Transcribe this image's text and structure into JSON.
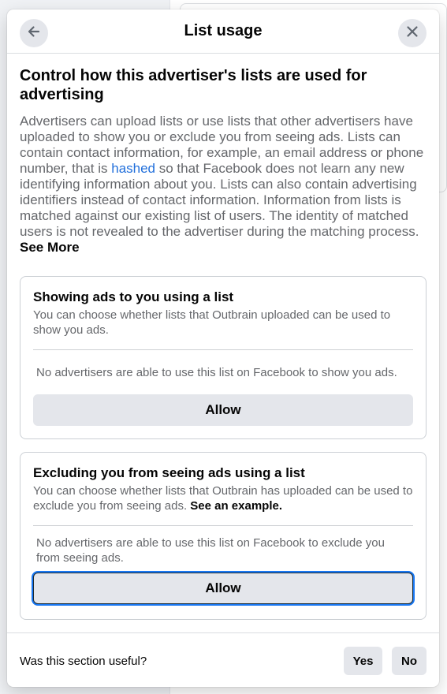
{
  "dialog": {
    "title": "List usage",
    "back_icon": "arrow-left-icon",
    "close_icon": "close-icon"
  },
  "intro": {
    "heading": "Control how this advertiser's lists are used for advertising",
    "para_part1": "Advertisers can upload lists or use lists that other advertisers have uploaded to show you or exclude you from seeing ads. Lists can contain contact information, for example, an email address or phone number, that is ",
    "link_hashed": "hashed",
    "para_part2": " so that Facebook does not learn any new identifying information about you. Lists can also contain advertising identifiers instead of contact information. Information from lists is matched against our existing list of users. The identity of matched users is not revealed to the advertiser during the matching process. ",
    "see_more": "See More"
  },
  "cards": [
    {
      "title": "Showing ads to you using a list",
      "description": "You can choose whether lists that Outbrain uploaded can be used to show you ads.",
      "note": "No advertisers are able to use this list on Facebook to show you ads.",
      "button": "Allow"
    },
    {
      "title": "Excluding you from seeing ads using a list",
      "description": "You can choose whether lists that Outbrain has uploaded can be used to exclude you from seeing ads. ",
      "link": "See an example.",
      "note": "No advertisers are able to use this list on Facebook to exclude you from seeing ads.",
      "button": "Allow"
    }
  ],
  "footer": {
    "question": "Was this section useful?",
    "yes": "Yes",
    "no": "No"
  },
  "colors": {
    "link": "#216fdb",
    "button_bg": "#e4e6eb",
    "focus_ring": "#1877f2",
    "secondary_text": "#65676b"
  }
}
